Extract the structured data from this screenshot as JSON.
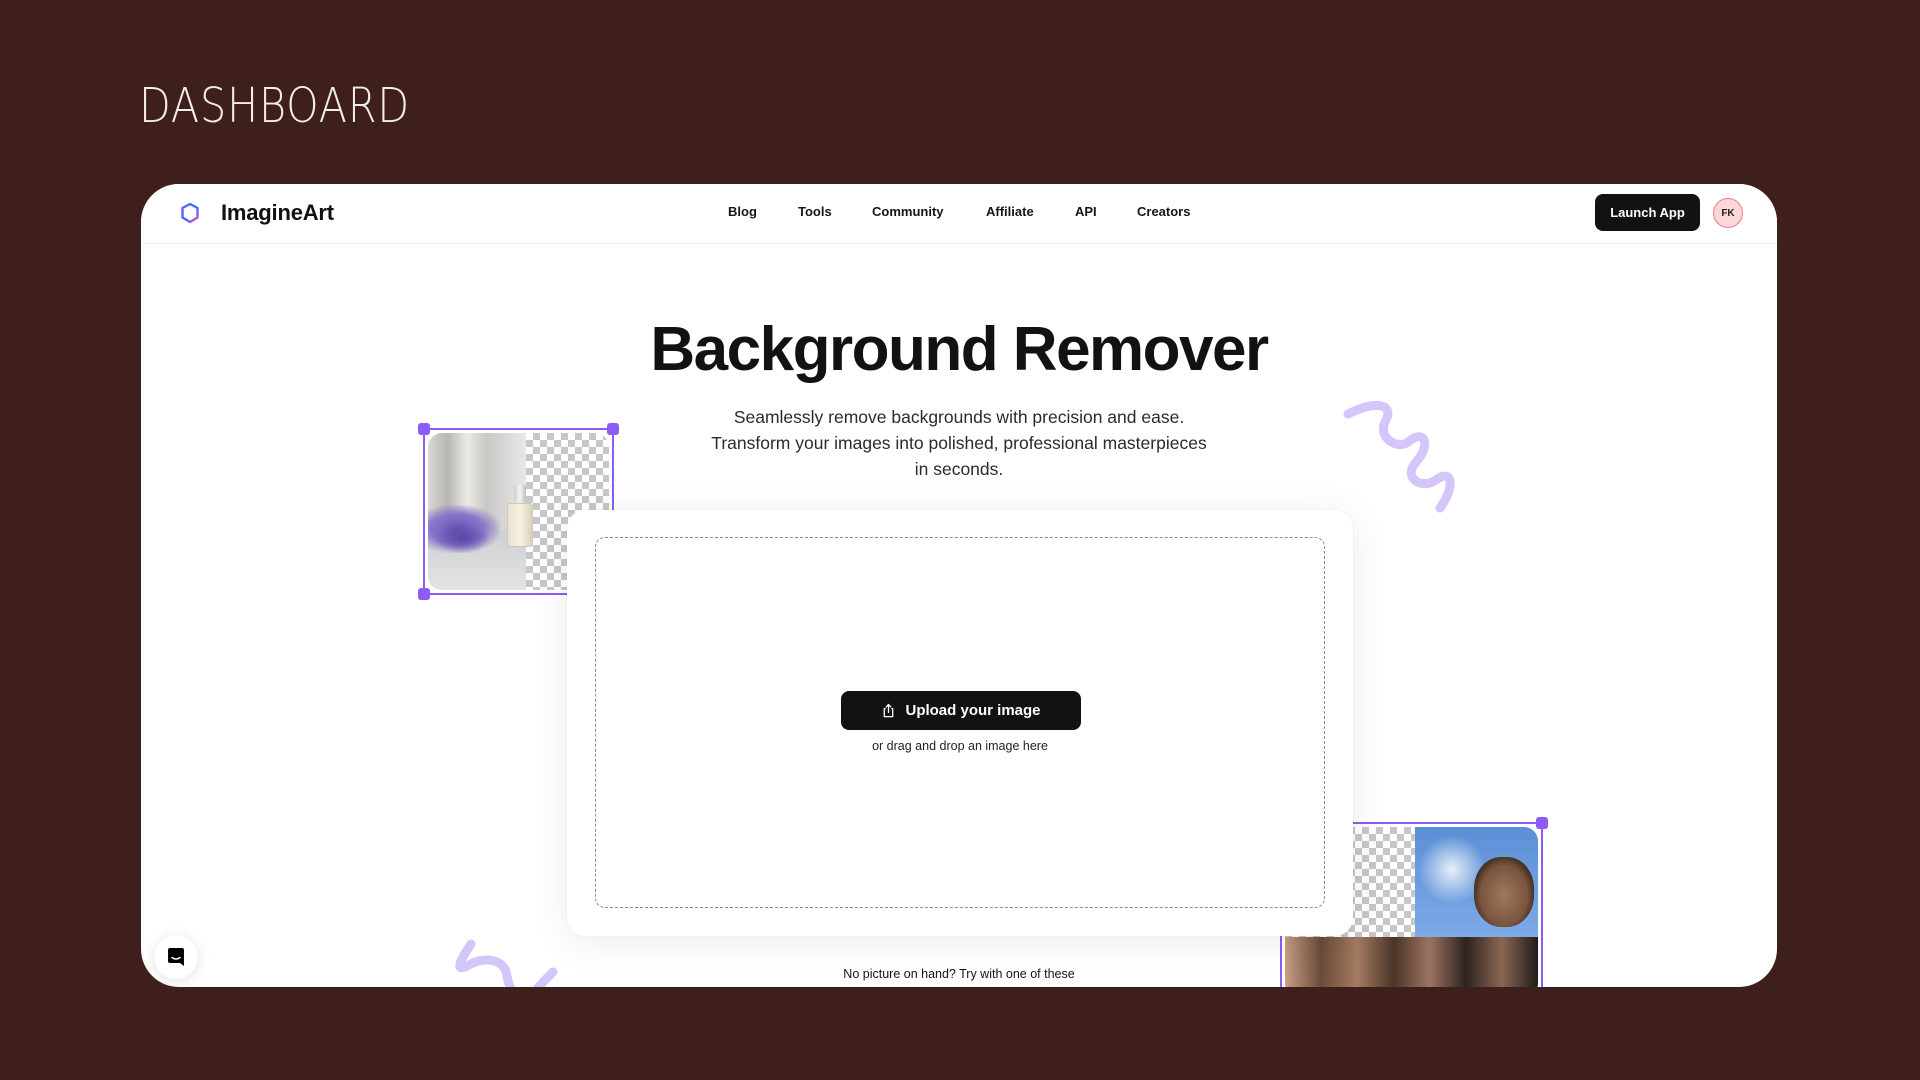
{
  "page_label": "DASHBOARD",
  "app": {
    "brand": "ImagineArt",
    "nav": [
      {
        "label": "Blog"
      },
      {
        "label": "Tools"
      },
      {
        "label": "Community"
      },
      {
        "label": "Affiliate"
      },
      {
        "label": "API"
      },
      {
        "label": "Creators"
      }
    ],
    "launch_label": "Launch App",
    "avatar_initials": "FK"
  },
  "hero": {
    "title": "Background Remover",
    "subtitle_lines": [
      "Seamlessly remove backgrounds with precision and ease.",
      "Transform your images into polished, professional masterpieces",
      "in seconds."
    ]
  },
  "uploader": {
    "button_label": "Upload your image",
    "button_icon": "upload-icon",
    "hint": "or drag and drop an image here"
  },
  "samples_prompt": "No picture on hand? Try with one of these",
  "icons": {
    "logo": "imagineart-hexagon-logo",
    "chat": "chat-support-icon"
  },
  "colors": {
    "page_bg": "#3e1f1b",
    "accent": "#8b5cf6",
    "squiggle": "#d4c6fb",
    "button_dark": "#111214",
    "avatar_bg": "#fcd7d9",
    "avatar_border": "#f37a84"
  }
}
